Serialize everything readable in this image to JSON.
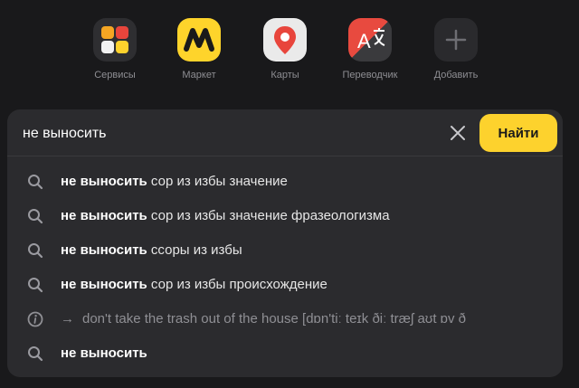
{
  "apps": [
    {
      "label": "Сервисы",
      "icon": "services-grid-icon"
    },
    {
      "label": "Маркет",
      "icon": "market-logo-icon"
    },
    {
      "label": "Карты",
      "icon": "map-pin-icon"
    },
    {
      "label": "Переводчик",
      "icon": "translator-icon"
    },
    {
      "label": "Добавить",
      "icon": "plus-icon"
    }
  ],
  "search": {
    "value": "не выносить",
    "button_label": "Найти"
  },
  "suggestions": [
    {
      "bold": "не выносить",
      "rest": " сор из избы значение",
      "icon": "search-icon"
    },
    {
      "bold": "не выносить",
      "rest": " сор из избы значение фразеологизма",
      "icon": "search-icon"
    },
    {
      "bold": "не выносить",
      "rest": " ссоры из избы",
      "icon": "search-icon"
    },
    {
      "bold": "не выносить",
      "rest": " сор из избы происхождение",
      "icon": "search-icon"
    },
    {
      "bold": "",
      "rest": "don't take the trash out of the house [dɒn'tiː teɪk ðiː træʃ aʊt ɒv ð",
      "icon": "info-icon",
      "arrow": "→"
    },
    {
      "bold": "не выносить",
      "rest": "",
      "icon": "search-icon"
    }
  ],
  "colors": {
    "background": "#19191b",
    "panel": "#2b2b2e",
    "accent_yellow": "#fdd22d"
  }
}
